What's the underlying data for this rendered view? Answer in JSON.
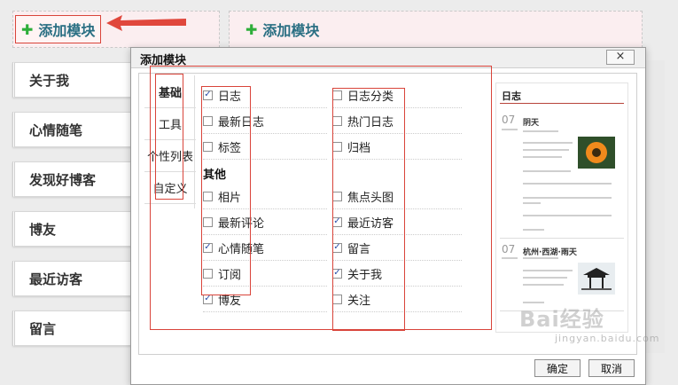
{
  "top": {
    "add_module_1": "添加模块",
    "add_module_2": "添加模块"
  },
  "sidebar": {
    "items": [
      "关于我",
      "心情随笔",
      "发现好博客",
      "博友",
      "最近访客",
      "留言"
    ]
  },
  "dialog": {
    "title": "添加模块",
    "close_label": "×",
    "tabs": [
      "基础",
      "工具",
      "个性列表",
      "自定义"
    ],
    "section_other": "其他",
    "left_options": [
      {
        "label": "日志",
        "checked": true
      },
      {
        "label": "最新日志",
        "checked": false
      },
      {
        "label": "标签",
        "checked": false
      },
      {
        "label": "相片",
        "checked": false
      },
      {
        "label": "最新评论",
        "checked": false
      },
      {
        "label": "心情随笔",
        "checked": true
      },
      {
        "label": "订阅",
        "checked": false
      },
      {
        "label": "博友",
        "checked": true
      }
    ],
    "right_options": [
      {
        "label": "日志分类",
        "checked": false
      },
      {
        "label": "热门日志",
        "checked": false
      },
      {
        "label": "归档",
        "checked": false
      },
      {
        "label": "焦点头图",
        "checked": false
      },
      {
        "label": "最近访客",
        "checked": true
      },
      {
        "label": "留言",
        "checked": true
      },
      {
        "label": "关于我",
        "checked": true
      },
      {
        "label": "关注",
        "checked": false
      }
    ],
    "preview": {
      "title": "日志",
      "post1_day": "07",
      "post1_title": "阴天",
      "post2_day": "07",
      "post2_title": "杭州·西湖·雨天"
    },
    "ok_label": "确定",
    "cancel_label": "取消"
  },
  "watermark": {
    "text": "Bai经验",
    "sub": "jingyan.baidu.com"
  },
  "colors": {
    "annotation_red": "#d9443a",
    "add_text": "#2a6f83",
    "plus_green": "#2eae3a"
  }
}
